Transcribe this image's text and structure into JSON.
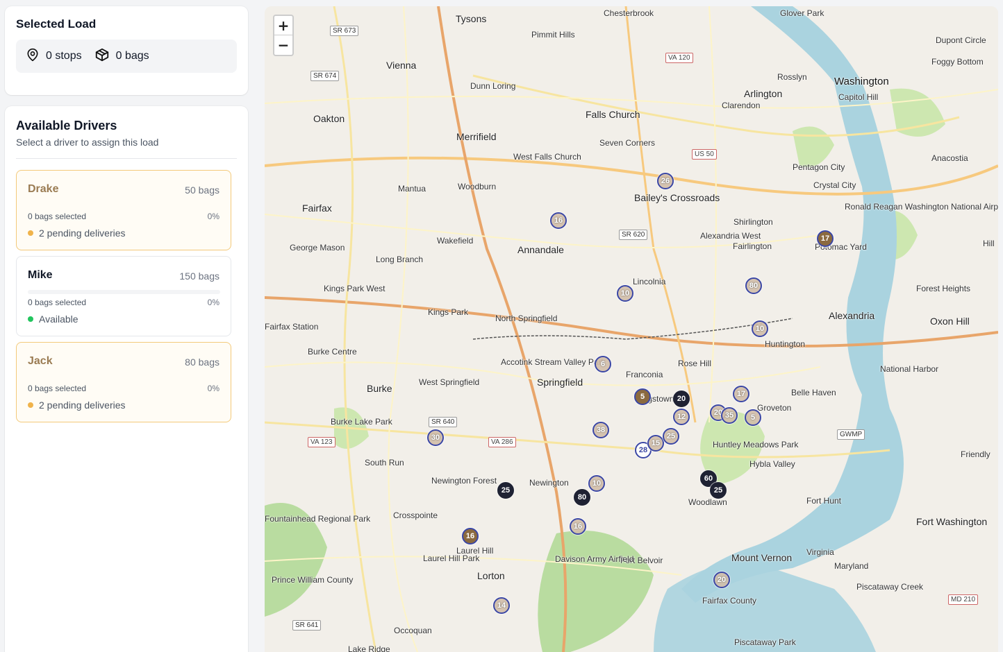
{
  "selected_load": {
    "title": "Selected Load",
    "stops": "0 stops",
    "bags": "0 bags"
  },
  "drivers_panel": {
    "title": "Available Drivers",
    "subtitle": "Select a driver to assign this load",
    "drivers": [
      {
        "name": "Drake",
        "capacity": "50 bags",
        "selected": "0 bags selected",
        "percent": "0%",
        "fill_fraction": 0,
        "status": "2 pending deliveries",
        "status_color": "#f0b34b"
      },
      {
        "name": "Mike",
        "capacity": "150 bags",
        "selected": "0 bags selected",
        "percent": "0%",
        "fill_fraction": 0,
        "status": "Available",
        "status_color": "#22c55e"
      },
      {
        "name": "Jack",
        "capacity": "80 bags",
        "selected": "0 bags selected",
        "percent": "0%",
        "fill_fraction": 0,
        "status": "2 pending deliveries",
        "status_color": "#f0b34b"
      }
    ]
  },
  "map": {
    "zoom_in": "+",
    "zoom_out": "−",
    "places": [
      "Tysons",
      "Pimmit Hills",
      "Chesterbrook",
      "Glover Park",
      "Dupont Circle",
      "Foggy Bottom",
      "Washington",
      "Vienna",
      "Dunn Loring",
      "Rosslyn",
      "Arlington",
      "Clarendon",
      "Capitol Hill",
      "Oakton",
      "Falls Church",
      "Merrifield",
      "Seven Corners",
      "West Falls Church",
      "Pentagon City",
      "Crystal City",
      "Anacostia",
      "Mantua",
      "Woodburn",
      "Fairfax",
      "Bailey's Crossroads",
      "Shirlington",
      "Fairlington",
      "Alexandria West",
      "George Mason",
      "Wakefield",
      "Annandale",
      "Long Branch",
      "Potomac Yard",
      "Kings Park West",
      "Lincolnia",
      "Forest Heights",
      "Kings Park",
      "North Springfield",
      "Alexandria",
      "Oxon Hill",
      "Huntington",
      "Burke Centre",
      "Rose Hill",
      "National Harbor",
      "Franconia",
      "Springfield",
      "West Springfield",
      "Burke",
      "Belle Haven",
      "Groveton",
      "Kingstowne",
      "Burke Lake Park",
      "Huntley Meadows Park",
      "Friendly",
      "Hybla Valley",
      "South Run",
      "Newington Forest",
      "Newington",
      "Woodlawn",
      "Fort Hunt",
      "Crosspointe",
      "Fort Washington",
      "Laurel Hill",
      "Fort Belvoir",
      "Mount Vernon",
      "Lorton",
      "Laurel Hill Park",
      "Davison Army Airfield",
      "Occoquan",
      "Lake Ridge",
      "Piscataway Creek",
      "Piscataway Park",
      "Virginia",
      "Maryland",
      "Fairfax County",
      "Prince William County",
      "Ronald Reagan Washington National Airport",
      "Accotink Stream Valley Park",
      "Fairfax Station",
      "Fountainhead Regional Park",
      "Hill"
    ],
    "shields": [
      "SR 673",
      "SR 674",
      "VA 120",
      "US 50",
      "SR 620",
      "SR 640",
      "VA 123",
      "VA 286",
      "GWMP",
      "MD 210",
      "SR 641"
    ],
    "clusters": [
      {
        "label": "26",
        "style": "light"
      },
      {
        "label": "16",
        "style": "light"
      },
      {
        "label": "17",
        "style": "brown"
      },
      {
        "label": "10",
        "style": "light"
      },
      {
        "label": "80",
        "style": "light"
      },
      {
        "label": "10",
        "style": "light"
      },
      {
        "label": "6",
        "style": "light"
      },
      {
        "label": "5",
        "style": "brown"
      },
      {
        "label": "20",
        "style": "dark"
      },
      {
        "label": "17",
        "style": "light"
      },
      {
        "label": "20",
        "style": "light"
      },
      {
        "label": "35",
        "style": "light"
      },
      {
        "label": "5",
        "style": "light"
      },
      {
        "label": "38",
        "style": "light"
      },
      {
        "label": "30",
        "style": "light"
      },
      {
        "label": "60",
        "style": "dark"
      },
      {
        "label": "25",
        "style": "dark"
      },
      {
        "label": "25",
        "style": "dark"
      },
      {
        "label": "16",
        "style": "brown"
      },
      {
        "label": "16",
        "style": "light"
      },
      {
        "label": "20",
        "style": "light"
      },
      {
        "label": "14",
        "style": "light"
      },
      {
        "label": "28",
        "style": "white"
      },
      {
        "label": "80",
        "style": "dark"
      },
      {
        "label": "15",
        "style": "light"
      },
      {
        "label": "10",
        "style": "light"
      },
      {
        "label": "12",
        "style": "light"
      },
      {
        "label": "25",
        "style": "light"
      }
    ]
  }
}
